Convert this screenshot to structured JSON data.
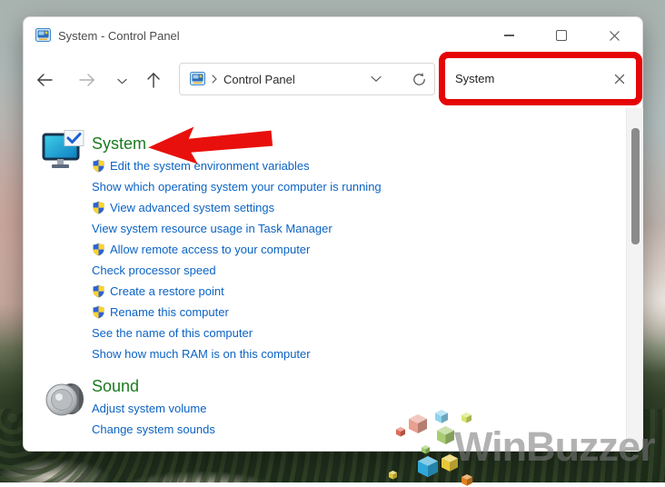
{
  "window": {
    "title": "System - Control Panel"
  },
  "address_bar": {
    "location": "Control Panel"
  },
  "search": {
    "value": "System"
  },
  "groups": [
    {
      "title": "System",
      "links": [
        {
          "label": "Edit the system environment variables",
          "shield": true
        },
        {
          "label": "Show which operating system your computer is running",
          "shield": false
        },
        {
          "label": "View advanced system settings",
          "shield": true
        },
        {
          "label": "View system resource usage in Task Manager",
          "shield": false
        },
        {
          "label": "Allow remote access to your computer",
          "shield": true
        },
        {
          "label": "Check processor speed",
          "shield": false
        },
        {
          "label": "Create a restore point",
          "shield": true
        },
        {
          "label": "Rename this computer",
          "shield": true
        },
        {
          "label": "See the name of this computer",
          "shield": false
        },
        {
          "label": "Show how much RAM is on this computer",
          "shield": false
        }
      ]
    },
    {
      "title": "Sound",
      "links": [
        {
          "label": "Adjust system volume",
          "shield": false
        },
        {
          "label": "Change system sounds",
          "shield": false
        }
      ]
    }
  ],
  "watermark": {
    "text": "WinBuzzer"
  },
  "colors": {
    "heading_green": "#1b7a1e",
    "link_blue": "#0b63c4",
    "annotation_red": "#e60505",
    "scrollbar_thumb": "#8a8a8a"
  }
}
